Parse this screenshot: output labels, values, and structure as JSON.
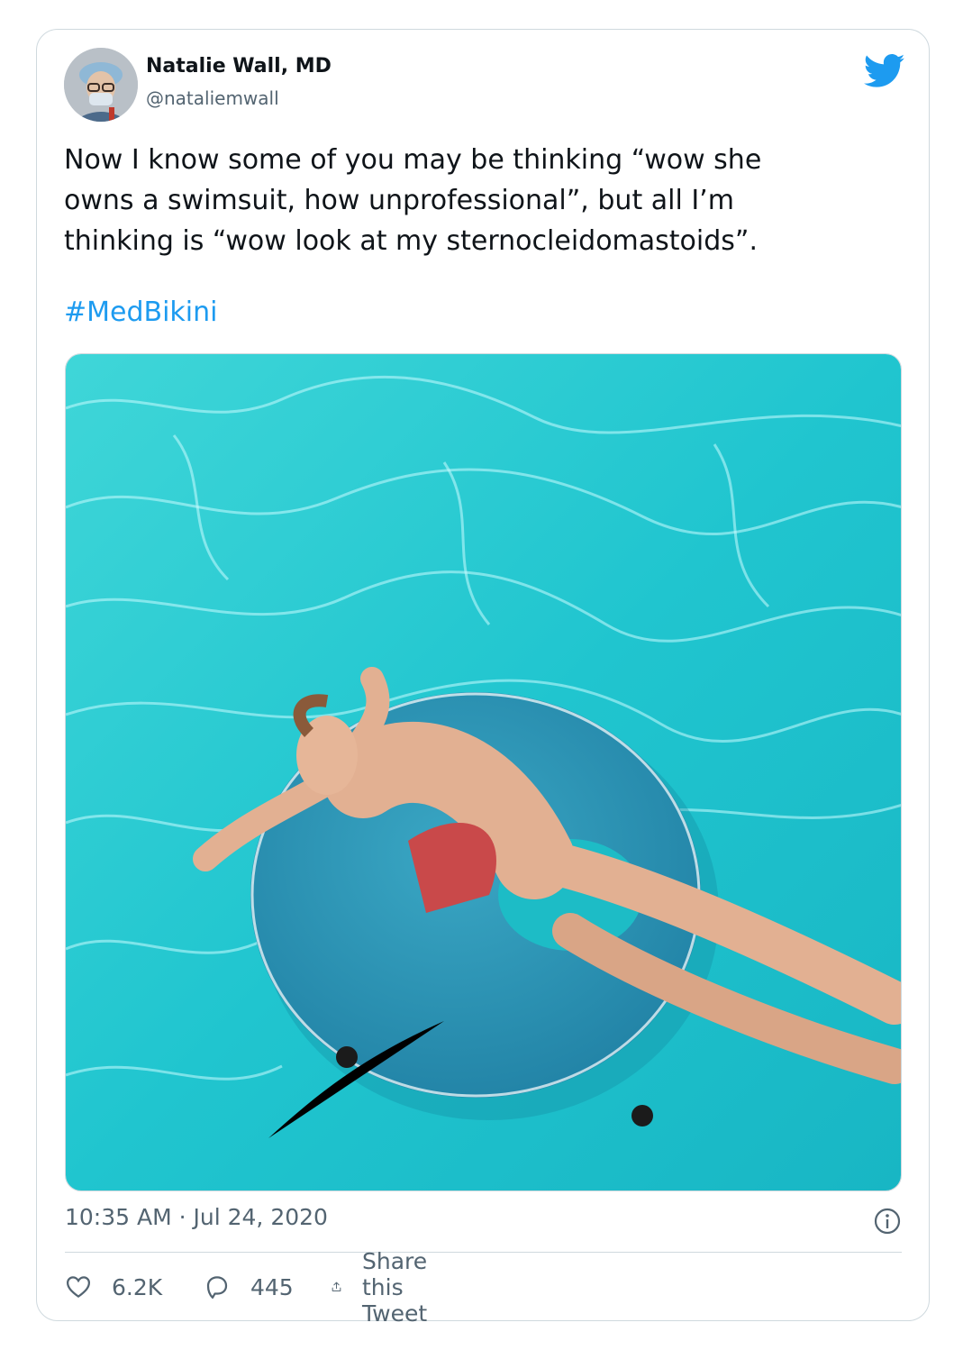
{
  "author": {
    "name": "Natalie Wall, MD",
    "handle": "@nataliemwall",
    "avatar_icon": "profile-photo"
  },
  "logo_icon": "twitter-bird-icon",
  "brand_color": "#1d9bf0",
  "tweet": {
    "text": "Now I know some of you may be thinking “wow she\nowns a swimsuit, how unprofessional”, but all I’m\nthinking is “wow look at my sternocleidomastoids”.",
    "hashtag": "#MedBikini"
  },
  "media": {
    "description_icon": "pool-photo"
  },
  "timestamp": "10:35 AM · Jul 24, 2020",
  "actions": {
    "like_count": "6.2K",
    "reply_count": "445",
    "share_label": "Share this Tweet"
  }
}
